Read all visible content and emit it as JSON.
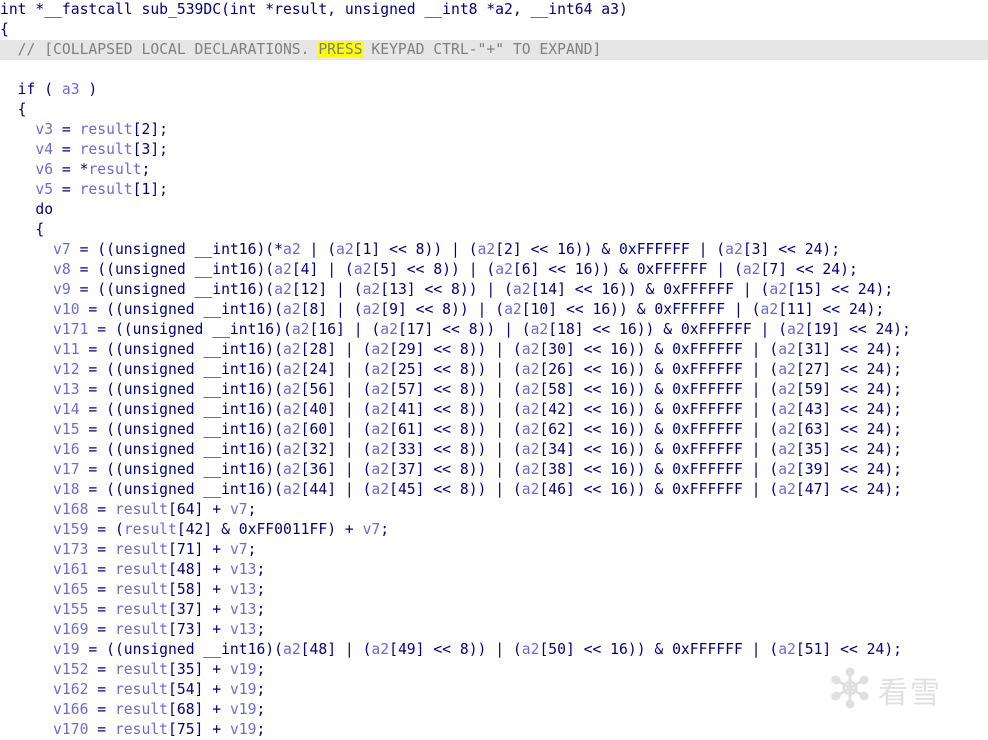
{
  "editor": {
    "lines": [
      [
        [
          "kw",
          "int *__fastcall sub_539DC(int *result, unsigned __int8 *a2, __int64 a3)"
        ]
      ],
      [
        [
          "op",
          "{"
        ]
      ],
      [
        [
          "cmt",
          "  // [COLLAPSED LOCAL DECLARATIONS. "
        ],
        [
          "mark",
          "PRESS"
        ],
        [
          "cmt",
          " KEYPAD CTRL-\"+\" TO EXPAND]"
        ]
      ],
      [
        [
          "plain",
          ""
        ]
      ],
      [
        [
          "kw",
          "  if ( "
        ],
        [
          "var",
          "a3"
        ],
        [
          "kw",
          " )"
        ]
      ],
      [
        [
          "op",
          "  {"
        ]
      ],
      [
        [
          "var",
          "    v3"
        ],
        [
          "op",
          " = "
        ],
        [
          "var",
          "result"
        ],
        [
          "op",
          "[2];"
        ]
      ],
      [
        [
          "var",
          "    v4"
        ],
        [
          "op",
          " = "
        ],
        [
          "var",
          "result"
        ],
        [
          "op",
          "[3];"
        ]
      ],
      [
        [
          "var",
          "    v6"
        ],
        [
          "op",
          " = *"
        ],
        [
          "var",
          "result"
        ],
        [
          "op",
          ";"
        ]
      ],
      [
        [
          "var",
          "    v5"
        ],
        [
          "op",
          " = "
        ],
        [
          "var",
          "result"
        ],
        [
          "op",
          "[1];"
        ]
      ],
      [
        [
          "kw",
          "    do"
        ]
      ],
      [
        [
          "op",
          "    {"
        ]
      ],
      [
        [
          "var",
          "      v7"
        ],
        [
          "op",
          " = ((unsigned __int16)(*"
        ],
        [
          "var",
          "a2"
        ],
        [
          "op",
          " | ("
        ],
        [
          "var",
          "a2"
        ],
        [
          "op",
          "[1] << 8)) | ("
        ],
        [
          "var",
          "a2"
        ],
        [
          "op",
          "[2] << 16)) & 0xFFFFFF | ("
        ],
        [
          "var",
          "a2"
        ],
        [
          "op",
          "[3] << 24);"
        ]
      ],
      [
        [
          "var",
          "      v8"
        ],
        [
          "op",
          " = ((unsigned __int16)("
        ],
        [
          "var",
          "a2"
        ],
        [
          "op",
          "[4] | ("
        ],
        [
          "var",
          "a2"
        ],
        [
          "op",
          "[5] << 8)) | ("
        ],
        [
          "var",
          "a2"
        ],
        [
          "op",
          "[6] << 16)) & 0xFFFFFF | ("
        ],
        [
          "var",
          "a2"
        ],
        [
          "op",
          "[7] << 24);"
        ]
      ],
      [
        [
          "var",
          "      v9"
        ],
        [
          "op",
          " = ((unsigned __int16)("
        ],
        [
          "var",
          "a2"
        ],
        [
          "op",
          "[12] | ("
        ],
        [
          "var",
          "a2"
        ],
        [
          "op",
          "[13] << 8)) | ("
        ],
        [
          "var",
          "a2"
        ],
        [
          "op",
          "[14] << 16)) & 0xFFFFFF | ("
        ],
        [
          "var",
          "a2"
        ],
        [
          "op",
          "[15] << 24);"
        ]
      ],
      [
        [
          "var",
          "      v10"
        ],
        [
          "op",
          " = ((unsigned __int16)("
        ],
        [
          "var",
          "a2"
        ],
        [
          "op",
          "[8] | ("
        ],
        [
          "var",
          "a2"
        ],
        [
          "op",
          "[9] << 8)) | ("
        ],
        [
          "var",
          "a2"
        ],
        [
          "op",
          "[10] << 16)) & 0xFFFFFF | ("
        ],
        [
          "var",
          "a2"
        ],
        [
          "op",
          "[11] << 24);"
        ]
      ],
      [
        [
          "var",
          "      v171"
        ],
        [
          "op",
          " = ((unsigned __int16)("
        ],
        [
          "var",
          "a2"
        ],
        [
          "op",
          "[16] | ("
        ],
        [
          "var",
          "a2"
        ],
        [
          "op",
          "[17] << 8)) | ("
        ],
        [
          "var",
          "a2"
        ],
        [
          "op",
          "[18] << 16)) & 0xFFFFFF | ("
        ],
        [
          "var",
          "a2"
        ],
        [
          "op",
          "[19] << 24);"
        ]
      ],
      [
        [
          "var",
          "      v11"
        ],
        [
          "op",
          " = ((unsigned __int16)("
        ],
        [
          "var",
          "a2"
        ],
        [
          "op",
          "[28] | ("
        ],
        [
          "var",
          "a2"
        ],
        [
          "op",
          "[29] << 8)) | ("
        ],
        [
          "var",
          "a2"
        ],
        [
          "op",
          "[30] << 16)) & 0xFFFFFF | ("
        ],
        [
          "var",
          "a2"
        ],
        [
          "op",
          "[31] << 24);"
        ]
      ],
      [
        [
          "var",
          "      v12"
        ],
        [
          "op",
          " = ((unsigned __int16)("
        ],
        [
          "var",
          "a2"
        ],
        [
          "op",
          "[24] | ("
        ],
        [
          "var",
          "a2"
        ],
        [
          "op",
          "[25] << 8)) | ("
        ],
        [
          "var",
          "a2"
        ],
        [
          "op",
          "[26] << 16)) & 0xFFFFFF | ("
        ],
        [
          "var",
          "a2"
        ],
        [
          "op",
          "[27] << 24);"
        ]
      ],
      [
        [
          "var",
          "      v13"
        ],
        [
          "op",
          " = ((unsigned __int16)("
        ],
        [
          "var",
          "a2"
        ],
        [
          "op",
          "[56] | ("
        ],
        [
          "var",
          "a2"
        ],
        [
          "op",
          "[57] << 8)) | ("
        ],
        [
          "var",
          "a2"
        ],
        [
          "op",
          "[58] << 16)) & 0xFFFFFF | ("
        ],
        [
          "var",
          "a2"
        ],
        [
          "op",
          "[59] << 24);"
        ]
      ],
      [
        [
          "var",
          "      v14"
        ],
        [
          "op",
          " = ((unsigned __int16)("
        ],
        [
          "var",
          "a2"
        ],
        [
          "op",
          "[40] | ("
        ],
        [
          "var",
          "a2"
        ],
        [
          "op",
          "[41] << 8)) | ("
        ],
        [
          "var",
          "a2"
        ],
        [
          "op",
          "[42] << 16)) & 0xFFFFFF | ("
        ],
        [
          "var",
          "a2"
        ],
        [
          "op",
          "[43] << 24);"
        ]
      ],
      [
        [
          "var",
          "      v15"
        ],
        [
          "op",
          " = ((unsigned __int16)("
        ],
        [
          "var",
          "a2"
        ],
        [
          "op",
          "[60] | ("
        ],
        [
          "var",
          "a2"
        ],
        [
          "op",
          "[61] << 8)) | ("
        ],
        [
          "var",
          "a2"
        ],
        [
          "op",
          "[62] << 16)) & 0xFFFFFF | ("
        ],
        [
          "var",
          "a2"
        ],
        [
          "op",
          "[63] << 24);"
        ]
      ],
      [
        [
          "var",
          "      v16"
        ],
        [
          "op",
          " = ((unsigned __int16)("
        ],
        [
          "var",
          "a2"
        ],
        [
          "op",
          "[32] | ("
        ],
        [
          "var",
          "a2"
        ],
        [
          "op",
          "[33] << 8)) | ("
        ],
        [
          "var",
          "a2"
        ],
        [
          "op",
          "[34] << 16)) & 0xFFFFFF | ("
        ],
        [
          "var",
          "a2"
        ],
        [
          "op",
          "[35] << 24);"
        ]
      ],
      [
        [
          "var",
          "      v17"
        ],
        [
          "op",
          " = ((unsigned __int16)("
        ],
        [
          "var",
          "a2"
        ],
        [
          "op",
          "[36] | ("
        ],
        [
          "var",
          "a2"
        ],
        [
          "op",
          "[37] << 8)) | ("
        ],
        [
          "var",
          "a2"
        ],
        [
          "op",
          "[38] << 16)) & 0xFFFFFF | ("
        ],
        [
          "var",
          "a2"
        ],
        [
          "op",
          "[39] << 24);"
        ]
      ],
      [
        [
          "var",
          "      v18"
        ],
        [
          "op",
          " = ((unsigned __int16)("
        ],
        [
          "var",
          "a2"
        ],
        [
          "op",
          "[44] | ("
        ],
        [
          "var",
          "a2"
        ],
        [
          "op",
          "[45] << 8)) | ("
        ],
        [
          "var",
          "a2"
        ],
        [
          "op",
          "[46] << 16)) & 0xFFFFFF | ("
        ],
        [
          "var",
          "a2"
        ],
        [
          "op",
          "[47] << 24);"
        ]
      ],
      [
        [
          "var",
          "      v168"
        ],
        [
          "op",
          " = "
        ],
        [
          "var",
          "result"
        ],
        [
          "op",
          "[64] + "
        ],
        [
          "var",
          "v7"
        ],
        [
          "op",
          ";"
        ]
      ],
      [
        [
          "var",
          "      v159"
        ],
        [
          "op",
          " = ("
        ],
        [
          "var",
          "result"
        ],
        [
          "op",
          "[42] & 0xFF0011FF) + "
        ],
        [
          "var",
          "v7"
        ],
        [
          "op",
          ";"
        ]
      ],
      [
        [
          "var",
          "      v173"
        ],
        [
          "op",
          " = "
        ],
        [
          "var",
          "result"
        ],
        [
          "op",
          "[71] + "
        ],
        [
          "var",
          "v7"
        ],
        [
          "op",
          ";"
        ]
      ],
      [
        [
          "var",
          "      v161"
        ],
        [
          "op",
          " = "
        ],
        [
          "var",
          "result"
        ],
        [
          "op",
          "[48] + "
        ],
        [
          "var",
          "v13"
        ],
        [
          "op",
          ";"
        ]
      ],
      [
        [
          "var",
          "      v165"
        ],
        [
          "op",
          " = "
        ],
        [
          "var",
          "result"
        ],
        [
          "op",
          "[58] + "
        ],
        [
          "var",
          "v13"
        ],
        [
          "op",
          ";"
        ]
      ],
      [
        [
          "var",
          "      v155"
        ],
        [
          "op",
          " = "
        ],
        [
          "var",
          "result"
        ],
        [
          "op",
          "[37] + "
        ],
        [
          "var",
          "v13"
        ],
        [
          "op",
          ";"
        ]
      ],
      [
        [
          "var",
          "      v169"
        ],
        [
          "op",
          " = "
        ],
        [
          "var",
          "result"
        ],
        [
          "op",
          "[73] + "
        ],
        [
          "var",
          "v13"
        ],
        [
          "op",
          ";"
        ]
      ],
      [
        [
          "var",
          "      v19"
        ],
        [
          "op",
          " = ((unsigned __int16)("
        ],
        [
          "var",
          "a2"
        ],
        [
          "op",
          "[48] | ("
        ],
        [
          "var",
          "a2"
        ],
        [
          "op",
          "[49] << 8)) | ("
        ],
        [
          "var",
          "a2"
        ],
        [
          "op",
          "[50] << 16)) & 0xFFFFFF | ("
        ],
        [
          "var",
          "a2"
        ],
        [
          "op",
          "[51] << 24);"
        ]
      ],
      [
        [
          "var",
          "      v152"
        ],
        [
          "op",
          " = "
        ],
        [
          "var",
          "result"
        ],
        [
          "op",
          "[35] + "
        ],
        [
          "var",
          "v19"
        ],
        [
          "op",
          ";"
        ]
      ],
      [
        [
          "var",
          "      v162"
        ],
        [
          "op",
          " = "
        ],
        [
          "var",
          "result"
        ],
        [
          "op",
          "[54] + "
        ],
        [
          "var",
          "v19"
        ],
        [
          "op",
          ";"
        ]
      ],
      [
        [
          "var",
          "      v166"
        ],
        [
          "op",
          " = "
        ],
        [
          "var",
          "result"
        ],
        [
          "op",
          "[68] + "
        ],
        [
          "var",
          "v19"
        ],
        [
          "op",
          ";"
        ]
      ],
      [
        [
          "var",
          "      v170"
        ],
        [
          "op",
          " = "
        ],
        [
          "var",
          "result"
        ],
        [
          "op",
          "[75] + "
        ],
        [
          "var",
          "v19"
        ],
        [
          "op",
          ";"
        ]
      ]
    ]
  },
  "watermark": {
    "text": "看雪",
    "icon": "snowflake-icon",
    "color": "#c8c8c8"
  },
  "colors": {
    "keyword": "#000080",
    "variable": "#6b6bd6",
    "comment": "#808080",
    "highlight": "#ffff00",
    "collapsed_bg": "#e6e6e6"
  }
}
